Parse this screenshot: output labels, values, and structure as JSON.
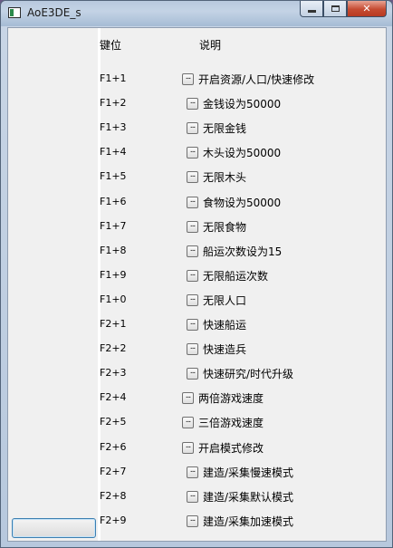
{
  "window": {
    "title": "AoE3DE_s"
  },
  "header": {
    "key_label": "键位",
    "desc_label": "说明"
  },
  "rows": [
    {
      "key": "F1+1",
      "dots": "...",
      "desc": "开启资源/人口/快速修改"
    },
    {
      "key": "F1+2",
      "dots": "...",
      "desc": "金钱设为50000"
    },
    {
      "key": "F1+3",
      "dots": "...",
      "desc": "无限金钱"
    },
    {
      "key": "F1+4",
      "dots": "...",
      "desc": "木头设为50000"
    },
    {
      "key": "F1+5",
      "dots": "...",
      "desc": "无限木头"
    },
    {
      "key": "F1+6",
      "dots": "...",
      "desc": "食物设为50000"
    },
    {
      "key": "F1+7",
      "dots": "...",
      "desc": "无限食物"
    },
    {
      "key": "F1+8",
      "dots": "...",
      "desc": "船运次数设为15"
    },
    {
      "key": "F1+9",
      "dots": "...",
      "desc": "无限船运次数"
    },
    {
      "key": "F1+0",
      "dots": "...",
      "desc": "无限人口"
    },
    {
      "key": "F2+1",
      "dots": "...",
      "desc": "快速船运"
    },
    {
      "key": "F2+2",
      "dots": "...",
      "desc": "快速造兵"
    },
    {
      "key": "F2+3",
      "dots": "...",
      "desc": "快速研究/时代升级"
    },
    {
      "key": "F2+4",
      "dots": "...",
      "desc": "两倍游戏速度"
    },
    {
      "key": "F2+5",
      "dots": "...",
      "desc": "三倍游戏速度"
    },
    {
      "key": "F2+6",
      "dots": "...",
      "desc": "开启模式修改"
    },
    {
      "key": "F2+7",
      "dots": "...",
      "desc": "建造/采集慢速模式"
    },
    {
      "key": "F2+8",
      "dots": "...",
      "desc": "建造/采集默认模式"
    },
    {
      "key": "F2+9",
      "dots": "...",
      "desc": "建造/采集加速模式"
    }
  ]
}
